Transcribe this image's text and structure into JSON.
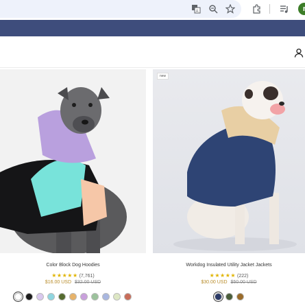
{
  "browser": {
    "icons": [
      "translate-icon",
      "zoom-icon",
      "bookmark-star-icon",
      "extensions-icon",
      "media-queue-icon"
    ],
    "profile_initial": "r"
  },
  "header": {
    "account_icon": "user-icon"
  },
  "products": [
    {
      "title": "Color Block Dog Hoodies",
      "rating_count": "(7,761)",
      "price": "$16.00 USD",
      "compare_price": "$32.00 USD",
      "badge": "",
      "swatches": [
        "#ffffff",
        "#1b1b1b",
        "#d9c8ee",
        "#8fd6e0",
        "#556b2f",
        "#e7b36a",
        "#c9a0dc",
        "#9cc29c",
        "#a9b7e0",
        "#dde7c4",
        "#c86d5a"
      ]
    },
    {
      "title": "Workdog Insulated Utility Jacket Jackets",
      "rating_count": "(222)",
      "price": "$30.00 USD",
      "compare_price": "$50.00 USD",
      "badge": "new",
      "swatches": [
        "#2b3a67",
        "#4a5d3a",
        "#9a6b2a"
      ]
    }
  ],
  "colors": {
    "banner": "#3e4d7c",
    "star": "#e0b400",
    "sale_price": "#b88c2a"
  }
}
